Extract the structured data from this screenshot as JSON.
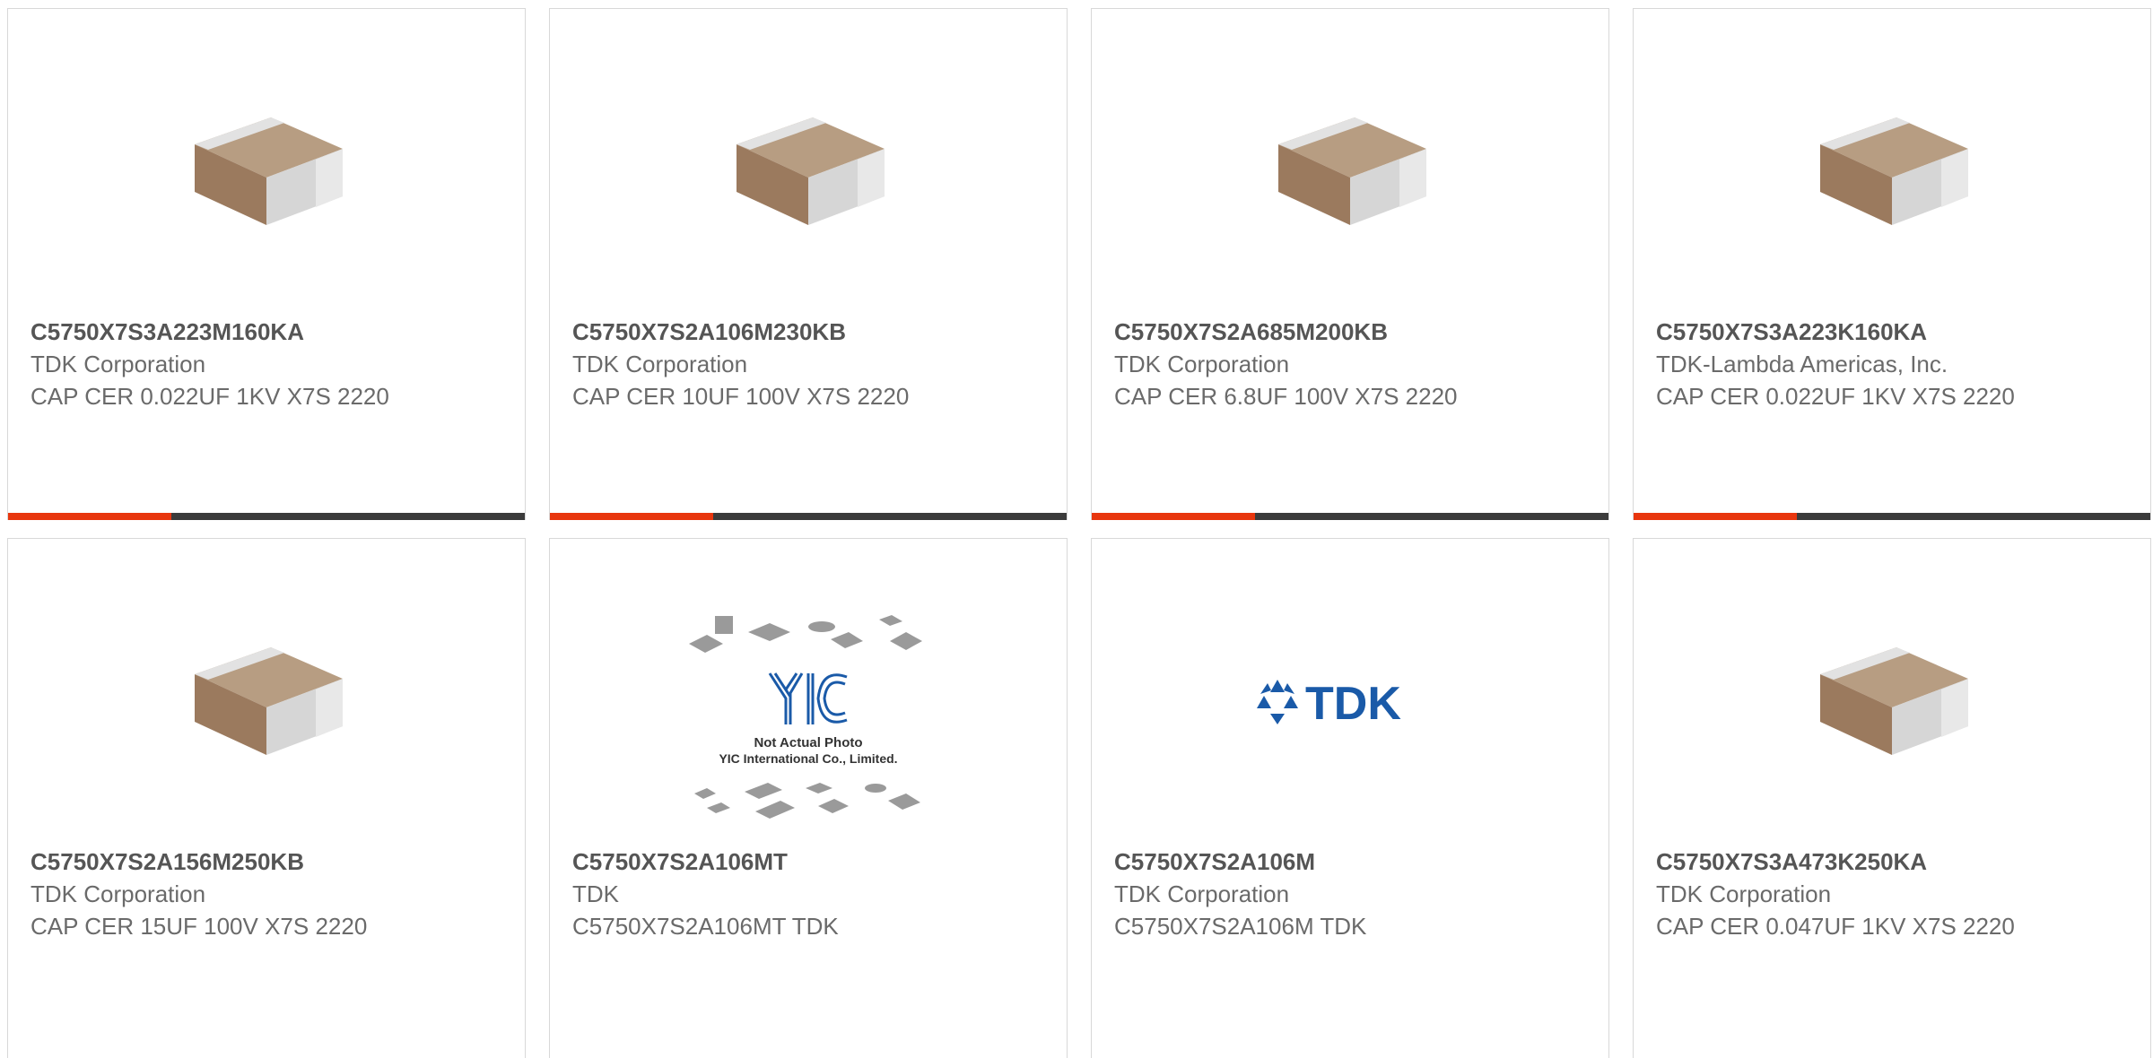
{
  "colors": {
    "accent": "#e8360e",
    "bar": "#3b3b3b",
    "title_text": "#555555",
    "body_text": "#6a6a6a",
    "border": "#d8d8d8",
    "tdk_blue": "#1a5aa8"
  },
  "products": [
    {
      "part_number": "C5750X7S3A223M160KA",
      "manufacturer": "TDK Corporation",
      "description": "CAP CER 0.022UF 1KV X7S 2220",
      "image": "capacitor-chip"
    },
    {
      "part_number": "C5750X7S2A106M230KB",
      "manufacturer": "TDK Corporation",
      "description": "CAP CER 10UF 100V X7S 2220",
      "image": "capacitor-chip"
    },
    {
      "part_number": "C5750X7S2A685M200KB",
      "manufacturer": "TDK Corporation",
      "description": "CAP CER 6.8UF 100V X7S 2220",
      "image": "capacitor-chip"
    },
    {
      "part_number": "C5750X7S3A223K160KA",
      "manufacturer": "TDK-Lambda Americas, Inc.",
      "description": "CAP CER 0.022UF 1KV X7S 2220",
      "image": "capacitor-chip"
    },
    {
      "part_number": "C5750X7S2A156M250KB",
      "manufacturer": "TDK Corporation",
      "description": "CAP CER 15UF 100V X7S 2220",
      "image": "capacitor-chip"
    },
    {
      "part_number": "C5750X7S2A106MT",
      "manufacturer": "TDK",
      "description": "C5750X7S2A106MT TDK",
      "image": "yic-placeholder",
      "image_text": {
        "logo": "YIC",
        "line1": "Not Actual Photo",
        "line2": "YIC International Co., Limited."
      }
    },
    {
      "part_number": "C5750X7S2A106M",
      "manufacturer": "TDK Corporation",
      "description": "C5750X7S2A106M TDK",
      "image": "tdk-logo",
      "image_text": {
        "logo": "TDK"
      }
    },
    {
      "part_number": "C5750X7S3A473K250KA",
      "manufacturer": "TDK Corporation",
      "description": "CAP CER 0.047UF 1KV X7S 2220",
      "image": "capacitor-chip"
    }
  ]
}
